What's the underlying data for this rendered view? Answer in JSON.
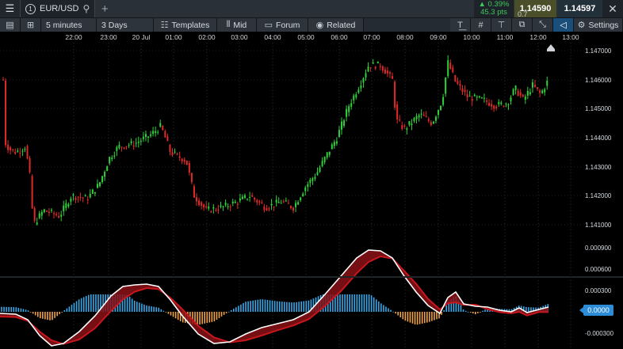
{
  "header": {
    "instrument_number": "1",
    "instrument": "EUR/USD",
    "change_pct": "▲ 0.39%",
    "change_pts": "45.3 pts",
    "bid": "1.14590",
    "ask": "1.14597",
    "spread": "0.7"
  },
  "toolbar": {
    "interval": "5 minutes",
    "range": "3 Days",
    "templates": "Templates",
    "mid": "Mid",
    "forum": "Forum",
    "related": "Related",
    "settings": "Settings"
  },
  "time_axis": [
    "22:00",
    "23:00",
    "20 Jul",
    "01:00",
    "02:00",
    "03:00",
    "04:00",
    "05:00",
    "06:00",
    "07:00",
    "08:00",
    "09:00",
    "10:00",
    "11:00",
    "12:00",
    "13:00"
  ],
  "price_axis": [
    "1.147000",
    "1.146000",
    "1.145000",
    "1.144000",
    "1.143000",
    "1.142000",
    "1.141000"
  ],
  "macd_axis": [
    "0.000900",
    "0.000600",
    "0.000300",
    "-0.000300"
  ],
  "macd_current": "0.0000",
  "colors": {
    "up": "#2fd13a",
    "down": "#e02a2a",
    "hist_pos": "#3aa7e6",
    "hist_neg": "#f0a34a",
    "signal": "#c8161d",
    "macd": "#ffffff",
    "accent": "#2d8cd8"
  }
}
